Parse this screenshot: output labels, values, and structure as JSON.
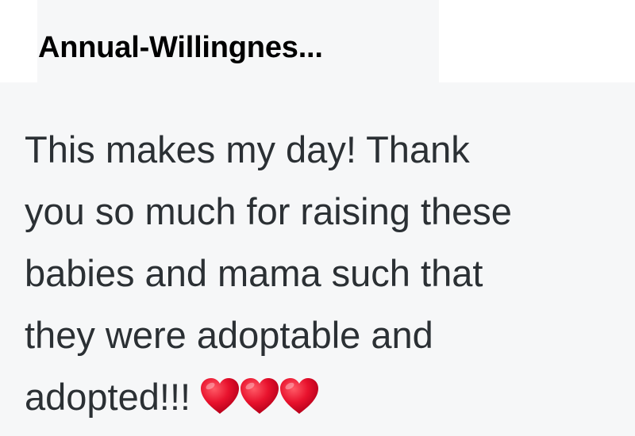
{
  "comment": {
    "username": "Annual-Willingnes...",
    "body_lines": [
      "This makes my day! Thank",
      "you so much for raising these",
      "babies and mama such that",
      "they were adoptable and",
      "adopted!!!"
    ],
    "emoji": [
      "red-heart",
      "red-heart",
      "red-heart"
    ]
  },
  "colors": {
    "background": "#f6f7f8",
    "username_text": "#000000",
    "body_text": "#2b3034",
    "heart": "#e8122d"
  }
}
